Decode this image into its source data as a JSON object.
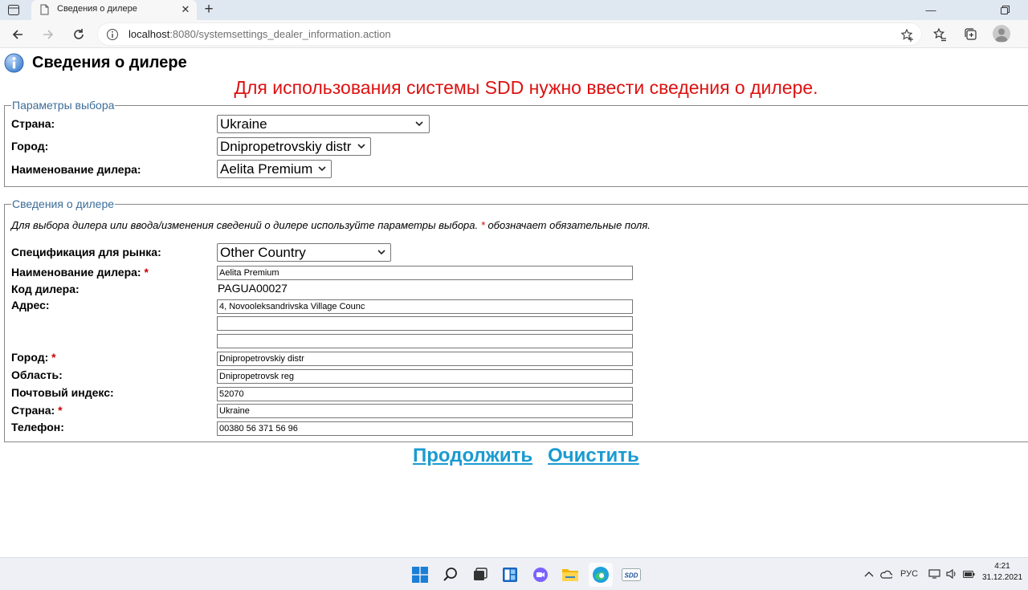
{
  "browser": {
    "tab_title": "Сведения о дилере",
    "url_host": "localhost",
    "url_path": ":8080/systemsettings_dealer_information.action"
  },
  "page": {
    "title": "Сведения о дилере",
    "warning": "Для использования системы SDD нужно ввести сведения о дилере."
  },
  "selection": {
    "legend": "Параметры выбора",
    "country_label": "Страна:",
    "country_value": "Ukraine",
    "city_label": "Город:",
    "city_value": "Dnipropetrovskiy distr",
    "dealer_label": "Наименование дилера:",
    "dealer_value": "Aelita Premium"
  },
  "details": {
    "legend": "Сведения о дилере",
    "note_text": "Для выбора дилера или ввода/изменения сведений о дилере используйте параметры выбора.",
    "note_star": "*",
    "note_rest": "обозначает обязательные поля.",
    "required_mark": "*",
    "market_label": "Спецификация для рынка:",
    "market_value": "Other Country",
    "dealer_name_label": "Наименование дилера:",
    "dealer_name_value": "Aelita Premium",
    "dealer_code_label": "Код дилера:",
    "dealer_code_value": "PAGUA00027",
    "address_label": "Адрес:",
    "address_line1": "4, Novooleksandrivska Village Counc",
    "address_line2": "",
    "address_line3": "",
    "city_label": "Город:",
    "city_value": "Dnipropetrovskiy distr",
    "region_label": "Область:",
    "region_value": "Dnipropetrovsk reg",
    "postal_label": "Почтовый индекс:",
    "postal_value": "52070",
    "country_label": "Страна:",
    "country_value": "Ukraine",
    "phone_label": "Телефон:",
    "phone_value": "00380 56 371 56 96"
  },
  "actions": {
    "continue": "Продолжить",
    "clear": "Очистить"
  },
  "taskbar": {
    "lang": "РУС",
    "time": "4:21",
    "date": "31.12.2021",
    "sdd_label": "SDD"
  },
  "colors": {
    "warning": "#dd1111",
    "legend": "#3c6c98",
    "link": "#1a9bd0",
    "required": "#cc0000"
  }
}
